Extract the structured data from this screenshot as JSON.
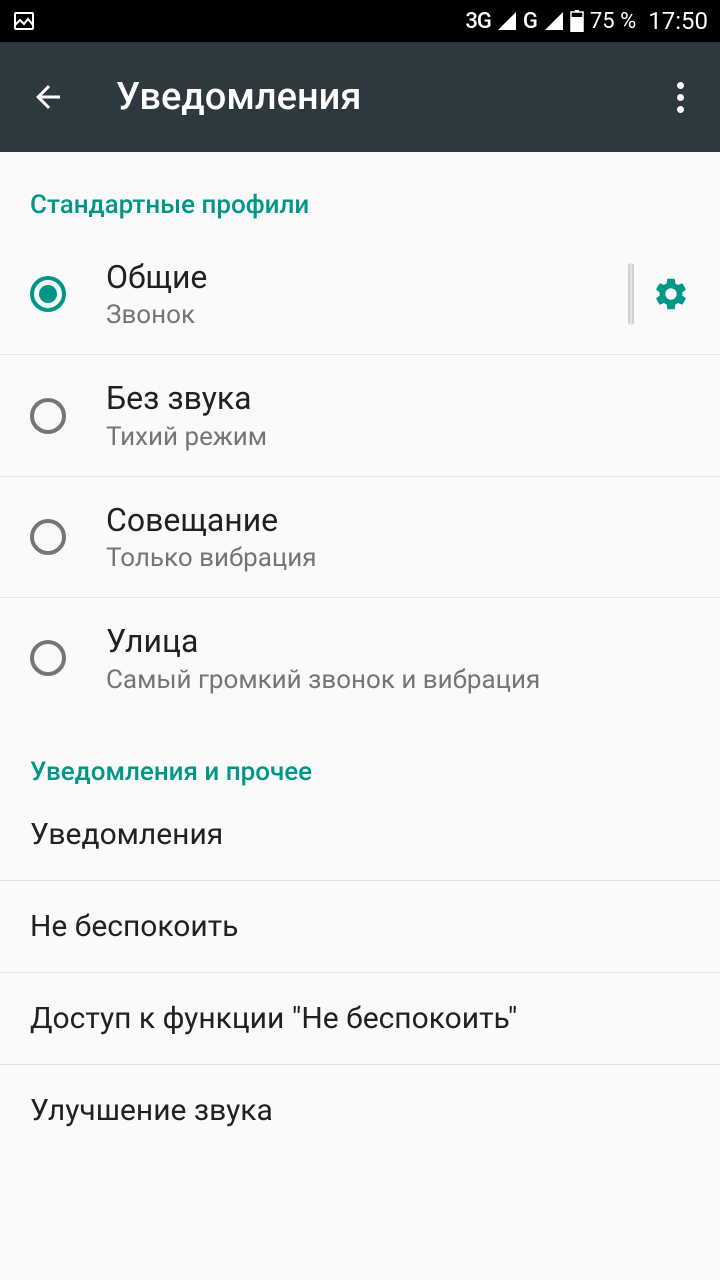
{
  "status": {
    "net1": "3G",
    "net2": "G",
    "battery": "75 %",
    "time": "17:50"
  },
  "appbar": {
    "title": "Уведомления"
  },
  "section1": {
    "header": "Стандартные профили",
    "items": [
      {
        "title": "Общие",
        "subtitle": "Звонок",
        "selected": true,
        "gear": true
      },
      {
        "title": "Без звука",
        "subtitle": "Тихий режим",
        "selected": false,
        "gear": false
      },
      {
        "title": "Совещание",
        "subtitle": "Только вибрация",
        "selected": false,
        "gear": false
      },
      {
        "title": "Улица",
        "subtitle": "Самый громкий звонок и вибрация",
        "selected": false,
        "gear": false
      }
    ]
  },
  "section2": {
    "header": "Уведомления и прочее",
    "items": [
      {
        "title": "Уведомления"
      },
      {
        "title": "Не беспокоить"
      },
      {
        "title": "Доступ к функции \"Не беспокоить\""
      },
      {
        "title": "Улучшение звука"
      }
    ]
  }
}
